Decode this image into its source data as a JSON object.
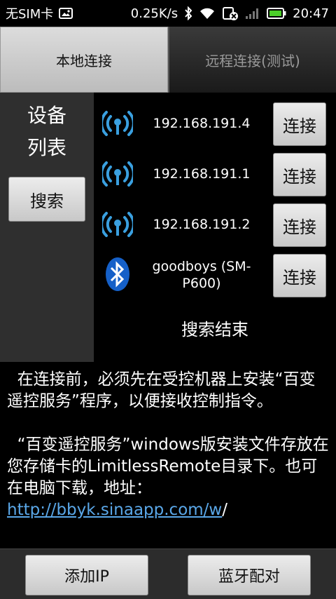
{
  "statusbar": {
    "carrier": "无SIM卡",
    "speed": "0.25K/s",
    "time": "20:47"
  },
  "tabs": [
    {
      "label": "本地连接",
      "active": true
    },
    {
      "label": "远程连接(测试)",
      "active": false
    }
  ],
  "left_panel": {
    "title": "设备\n列表",
    "search_label": "搜索"
  },
  "devices": [
    {
      "icon": "wifi-icon",
      "label": "192.168.191.4",
      "button": "连接"
    },
    {
      "icon": "wifi-icon",
      "label": "192.168.191.1",
      "button": "连接"
    },
    {
      "icon": "wifi-icon",
      "label": "192.168.191.2",
      "button": "连接"
    },
    {
      "icon": "bluetooth-icon",
      "label": "goodboys (SM-P600)",
      "button": "连接"
    }
  ],
  "search_status": "搜索结束",
  "info": {
    "para1": "  在连接前，必须先在受控机器上安装“百变遥控服务”程序，以便接收控制指令。",
    "para2_text": "  “百变遥控服务”windows版安装文件存放在您存储卡的LimitlessRemote目录下。也可在电脑下载，地址：",
    "para2_link": "http://bbyk.sinaapp.com/w",
    "para2_tail": "/"
  },
  "bottom": {
    "add_ip_label": "添加IP",
    "bt_pair_label": "蓝牙配对"
  },
  "colors": {
    "link": "#5aa7e8",
    "wifi_blue": "#3aa0e0",
    "bluetooth_blue": "#1560c8"
  }
}
